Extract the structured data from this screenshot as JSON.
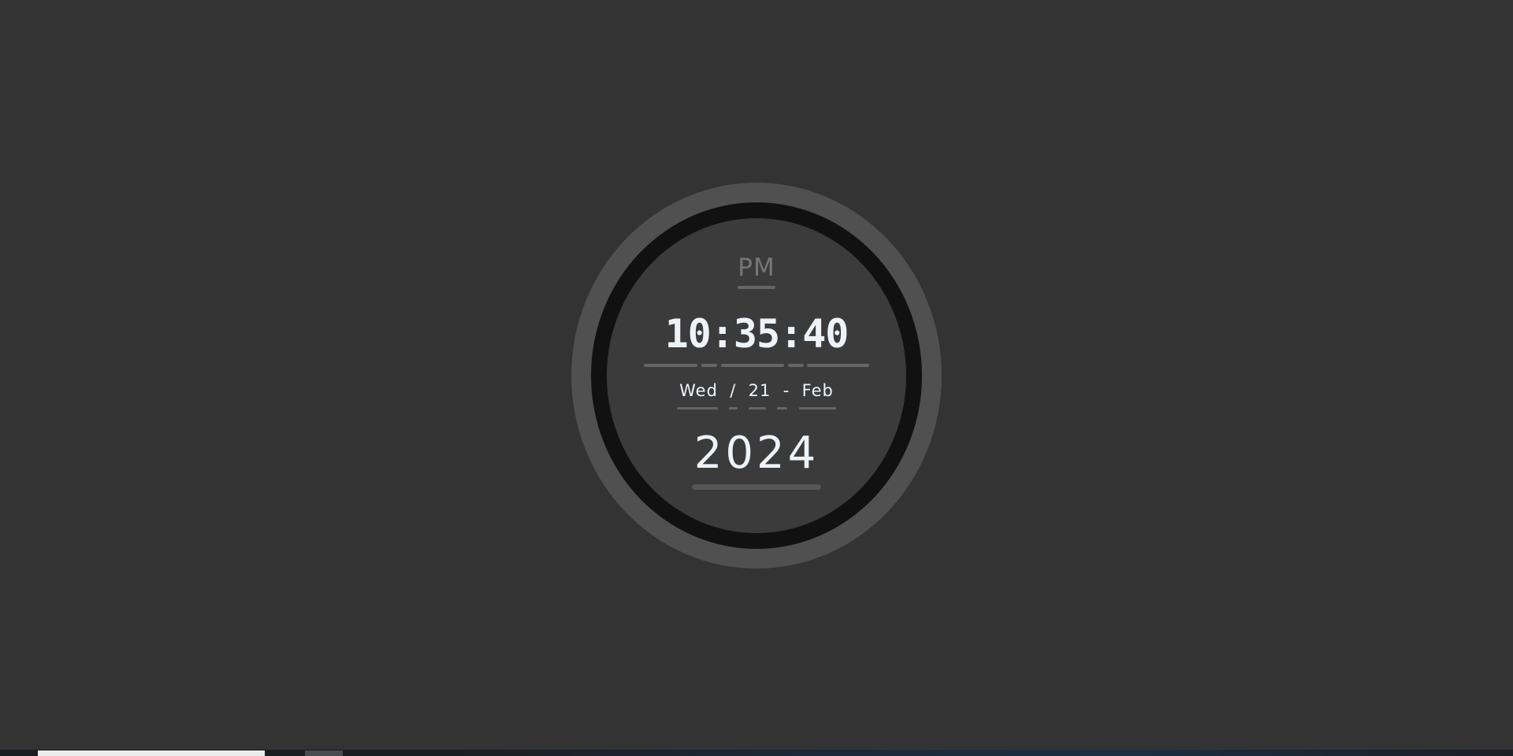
{
  "clock": {
    "ampm": "PM",
    "time": "10:35:40",
    "date": "Wed  /  21  -  Feb",
    "year": "2024"
  },
  "colors": {
    "background": "#333333",
    "outer_ring": "#505050",
    "inner_ring": "#111111",
    "face": "#3b3b3b",
    "text": "#eef3fa",
    "muted": "#777777"
  }
}
